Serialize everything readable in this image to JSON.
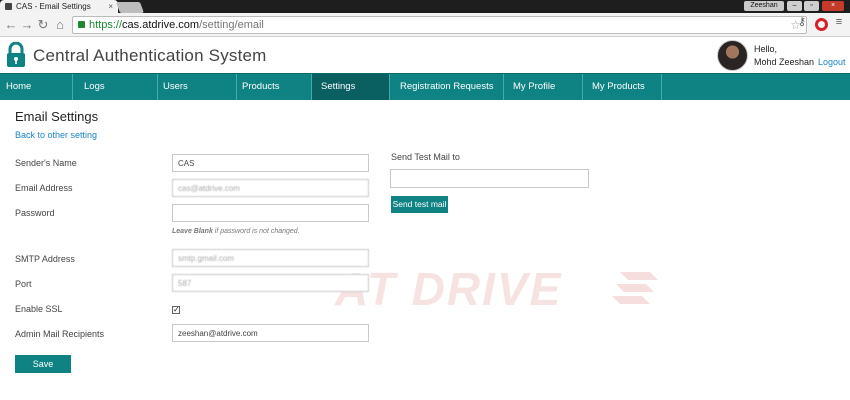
{
  "browser": {
    "tab_title": "CAS - Email Settings",
    "tab_close": "×",
    "window_user": "Zeeshan",
    "window_buttons": [
      "–",
      "▫",
      "×"
    ],
    "url_scheme": "https://",
    "url_host": "cas.atdrive.com",
    "url_path": "/setting/email",
    "icons": [
      "back-icon",
      "forward-icon",
      "reload-icon",
      "home-icon",
      "star-icon",
      "key-icon",
      "opera-icon",
      "menu-icon"
    ]
  },
  "app": {
    "title": "Central Authentication System",
    "greeting": "Hello,",
    "user_name": "Mohd Zeeshan",
    "logout_label": "Logout"
  },
  "nav": [
    {
      "label": "Home"
    },
    {
      "label": "Logs"
    },
    {
      "label": "Users"
    },
    {
      "label": "Products"
    },
    {
      "label": "Settings",
      "active": true
    },
    {
      "label": "Registration Requests (0)"
    },
    {
      "label": "My Profile"
    },
    {
      "label": "My Products"
    }
  ],
  "page": {
    "title": "Email Settings",
    "back_link": "Back to other setting"
  },
  "form": {
    "sender_name": {
      "label": "Sender's Name",
      "value": "CAS"
    },
    "email_address": {
      "label": "Email Address",
      "value": "cas@atdrive.com"
    },
    "password": {
      "label": "Password",
      "value": ""
    },
    "password_hint_bold": "Leave Blank",
    "password_hint_rest": " if password is not changed.",
    "smtp_address": {
      "label": "SMTP Address",
      "value": "smtp.gmail.com"
    },
    "port": {
      "label": "Port",
      "value": "587"
    },
    "enable_ssl": {
      "label": "Enable SSL",
      "checked": true
    },
    "admin_recipients": {
      "label": "Admin Mail Recipients",
      "value": "zeeshan@atdrive.com"
    },
    "save_label": "Save"
  },
  "test_mail": {
    "label": "Send Test Mail to",
    "value": "",
    "button_label": "Send test mail"
  },
  "watermark": "AT DRIVE",
  "colors": {
    "accent": "#0f8284",
    "nav_active": "#0a5f61",
    "link": "#1a85c8"
  }
}
